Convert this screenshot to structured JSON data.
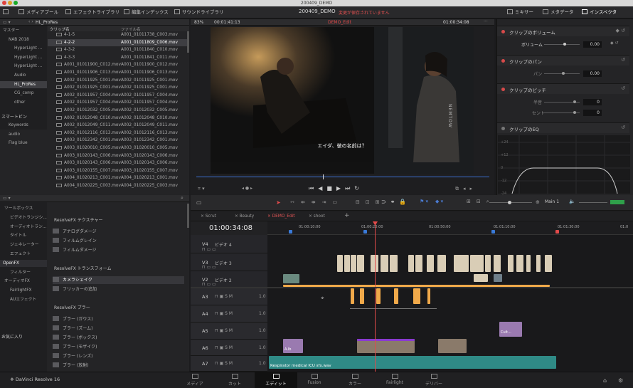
{
  "window": {
    "title": "200409_DEMO"
  },
  "toolbar": {
    "media_pool": "メディアプール",
    "effects_library": "エフェクトライブラリ",
    "edit_index": "編集インデックス",
    "sound_library": "サウンドライブラリ",
    "project_name": "200409_DEMO",
    "unsaved_notice": "変更が保存されていません",
    "mixer": "ミキサー",
    "metadata": "メタデータ",
    "inspector": "インスペクタ"
  },
  "media_pool": {
    "current_bin": "HL_ProRes",
    "col_clip": "クリップ名",
    "col_file": "ファイル名",
    "bins": [
      {
        "label": "マスター",
        "selected": false
      },
      {
        "label": "NAB 2018",
        "selected": false
      },
      {
        "label": "HyperLight ...",
        "selected": false
      },
      {
        "label": "HyperLight ...",
        "selected": false
      },
      {
        "label": "HyperLight ...",
        "selected": false
      },
      {
        "label": "Audio",
        "selected": false
      },
      {
        "label": "HL_ProRes",
        "selected": true
      },
      {
        "label": "CG_comp",
        "selected": false
      },
      {
        "label": "other",
        "selected": false
      }
    ],
    "smart_bins_title": "スマートビン",
    "smart_bins": [
      "Keywords",
      "audio",
      "Flag blue"
    ],
    "clips": [
      {
        "name": "4-1-5",
        "file": "A001_01011738_C003.mov",
        "selected": false
      },
      {
        "name": "4-2-2",
        "file": "A001_01011809_C006.mov",
        "selected": true
      },
      {
        "name": "4-3-2",
        "file": "A001_01011840_C010.mov",
        "selected": false
      },
      {
        "name": "4-3-3",
        "file": "A001_01011841_C011.mov",
        "selected": false
      },
      {
        "name": "A001_01011900_C012.mov",
        "file": "A001_01011900_C012.mov",
        "selected": false
      },
      {
        "name": "A001_01011906_C013.mov",
        "file": "A001_01011906_C013.mov",
        "selected": false
      },
      {
        "name": "A002_01011925_C001.mov",
        "file": "A002_01011925_C001.mov",
        "selected": false
      },
      {
        "name": "A002_01011925_C001.mov",
        "file": "A002_01011925_C001.mov",
        "selected": false
      },
      {
        "name": "A002_01011957_C004.mov",
        "file": "A002_01011957_C004.mov",
        "selected": false
      },
      {
        "name": "A002_01011957_C004.mov",
        "file": "A002_01011957_C004.mov",
        "selected": false
      },
      {
        "name": "A002_01012032_C005.mov",
        "file": "A002_01012032_C005.mov",
        "selected": false
      },
      {
        "name": "A002_01012048_C010.mov",
        "file": "A002_01012048_C010.mov",
        "selected": false
      },
      {
        "name": "A002_01012049_C011.mov",
        "file": "A002_01012049_C011.mov",
        "selected": false
      },
      {
        "name": "A002_01012116_C013.mov",
        "file": "A002_01012116_C013.mov",
        "selected": false
      },
      {
        "name": "A003_01012342_C001.mov",
        "file": "A003_01012342_C001.mov",
        "selected": false
      },
      {
        "name": "A003_01020010_C005.mov",
        "file": "A003_01020010_C005.mov",
        "selected": false
      },
      {
        "name": "A003_01020143_C006.mov",
        "file": "A003_01020143_C006.mov",
        "selected": false
      },
      {
        "name": "A003_01020143_C006.mov",
        "file": "A003_01020143_C006.mov",
        "selected": false
      },
      {
        "name": "A003_01020155_C007.mov",
        "file": "A003_01020155_C007.mov",
        "selected": false
      },
      {
        "name": "A004_01020213_C001.mov",
        "file": "A004_01020213_C001.mov",
        "selected": false
      },
      {
        "name": "A004_01020225_C003.mov",
        "file": "A004_01020225_C003.mov",
        "selected": false
      }
    ]
  },
  "viewer": {
    "zoom": "83%",
    "source_tc": "00:01:41:13",
    "timeline_name": "DEMO_Edit",
    "record_tc": "01:00:34:08",
    "subtitle": "エイダ、彼の名前は？",
    "tv_logo": "NEMTOW"
  },
  "inspector": {
    "volume_section": "クリップのボリューム",
    "volume_label": "ボリューム",
    "volume_value": "0.00",
    "pan_section": "クリップのパン",
    "pan_label": "パン",
    "pan_value": "0.00",
    "pitch_section": "クリップのピッチ",
    "semitone_label": "半音",
    "semitone_value": "0",
    "cent_label": "セント",
    "cent_value": "0",
    "eq_section": "クリップのEQ",
    "eq_db_labels": [
      "+24",
      "+12",
      "0",
      "-12",
      "-24"
    ]
  },
  "effects": {
    "tree": [
      {
        "label": "ツールボックス",
        "selected": false
      },
      {
        "label": "ビデオトランジシ...",
        "selected": false
      },
      {
        "label": "オーディオトラン...",
        "selected": false
      },
      {
        "label": "タイトル",
        "selected": false
      },
      {
        "label": "ジェネレーター",
        "selected": false
      },
      {
        "label": "エフェクト",
        "selected": false
      },
      {
        "label": "OpenFX",
        "selected": true
      },
      {
        "label": "フィルター",
        "selected": false
      },
      {
        "label": "オーディオFX",
        "selected": false
      },
      {
        "label": "FairlightFX",
        "selected": false
      },
      {
        "label": "AUエフェクト",
        "selected": false
      }
    ],
    "favorites_title": "お気に入り",
    "sections": [
      {
        "title": "ResolveFX テクスチャー",
        "items": [
          {
            "label": "アナログダメージ",
            "selected": false
          },
          {
            "label": "フィルムグレイン",
            "selected": false
          },
          {
            "label": "フィルムダメージ",
            "selected": false
          }
        ]
      },
      {
        "title": "ResolveFX トランスフォーム",
        "items": [
          {
            "label": "カメラシェイク",
            "selected": true
          },
          {
            "label": "フリッカーの追加",
            "selected": false
          }
        ]
      },
      {
        "title": "ResolveFX ブラー",
        "items": [
          {
            "label": "ブラー (ガウス)",
            "selected": false
          },
          {
            "label": "ブラー (ズーム)",
            "selected": false
          },
          {
            "label": "ブラー (ボックス)",
            "selected": false
          },
          {
            "label": "ブラー (モザイク)",
            "selected": false
          },
          {
            "label": "ブラー (レンズ)",
            "selected": false
          },
          {
            "label": "ブラー (放射)",
            "selected": false
          },
          {
            "label": "ブラー (方向)",
            "selected": false
          }
        ]
      }
    ]
  },
  "timeline": {
    "timecode": "01:00:34:08",
    "tabs": [
      "Scrut",
      "Beauty",
      "DEMO_Edit",
      "shoot"
    ],
    "active_tab": "DEMO_Edit",
    "main_track": "Main 1",
    "ruler_labels": [
      "01:00:10:00",
      "01:00:20:00",
      "01:00:50:00",
      "01:01:10:00",
      "01:01:30:00",
      "01:0"
    ],
    "tracks": [
      {
        "id": "V4",
        "name": "ビデオ 4",
        "kind": "video"
      },
      {
        "id": "V3",
        "name": "ビデオ 3",
        "kind": "video"
      },
      {
        "id": "V2",
        "name": "ビデオ 2",
        "kind": "video"
      },
      {
        "id": "A3",
        "name": "",
        "kind": "audio",
        "gain": "1.0"
      },
      {
        "id": "A4",
        "name": "",
        "kind": "audio",
        "gain": "1.0"
      },
      {
        "id": "A5",
        "name": "",
        "kind": "audio",
        "gain": "1.0"
      },
      {
        "id": "A6",
        "name": "",
        "kind": "audio",
        "gain": "1.0"
      },
      {
        "id": "A7",
        "name": "",
        "kind": "audio",
        "gain": "1.0"
      }
    ],
    "audio_clip_name": "Respirator medical ICU sfx.wav",
    "small_clip_a6": "A.lb",
    "small_clip_a5": "Cult..."
  },
  "bottom_nav": {
    "app_name": "DaVinci Resolve 16",
    "pages": [
      "メディア",
      "カット",
      "エディット",
      "Fusion",
      "カラー",
      "Fairlight",
      "デリバー"
    ],
    "active": "エディット"
  },
  "colors": {
    "accent_red": "#e04a4a",
    "clip_beige": "#d9cdb6",
    "clip_orange": "#f0a94a",
    "audio_teal": "#2f8a86",
    "clip_purple": "#9a7ab0"
  }
}
